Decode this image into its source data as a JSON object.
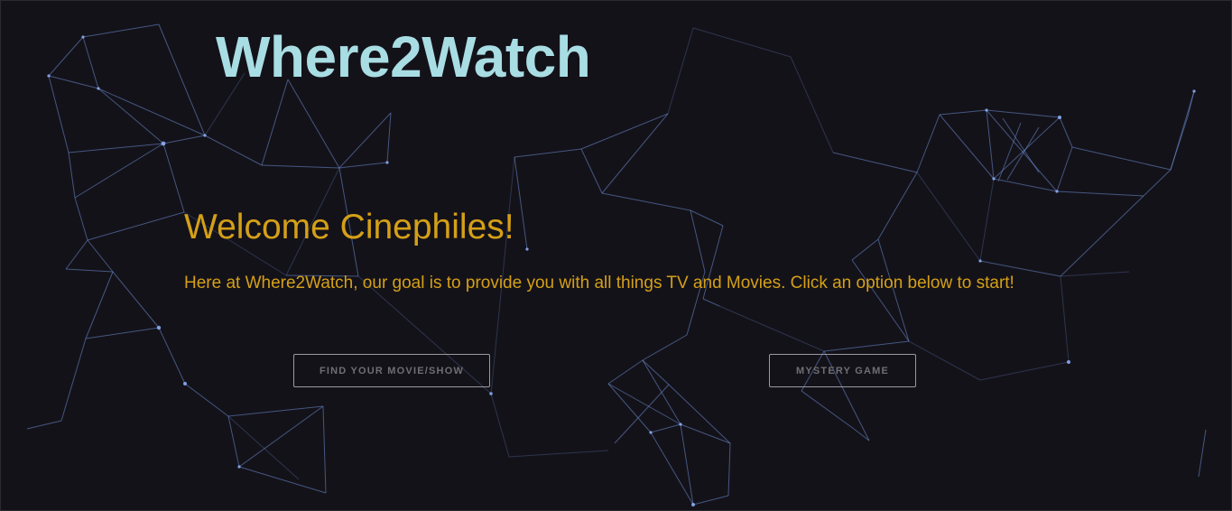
{
  "header": {
    "brand": "Where2Watch"
  },
  "hero": {
    "heading": "Welcome Cinephiles!",
    "intro": "Here at Where2Watch, our goal is to provide you with all things TV and Movies. Click an option below to start!"
  },
  "actions": {
    "find_label": "FIND YOUR MOVIE/SHOW",
    "mystery_label": "MYSTERY GAME"
  },
  "colors": {
    "background": "#141219",
    "brand": "#a9dde4",
    "accent": "#d4a017",
    "network": "#6b8fd6",
    "button_border": "#9a9aa0",
    "button_text": "#6e6e74"
  }
}
